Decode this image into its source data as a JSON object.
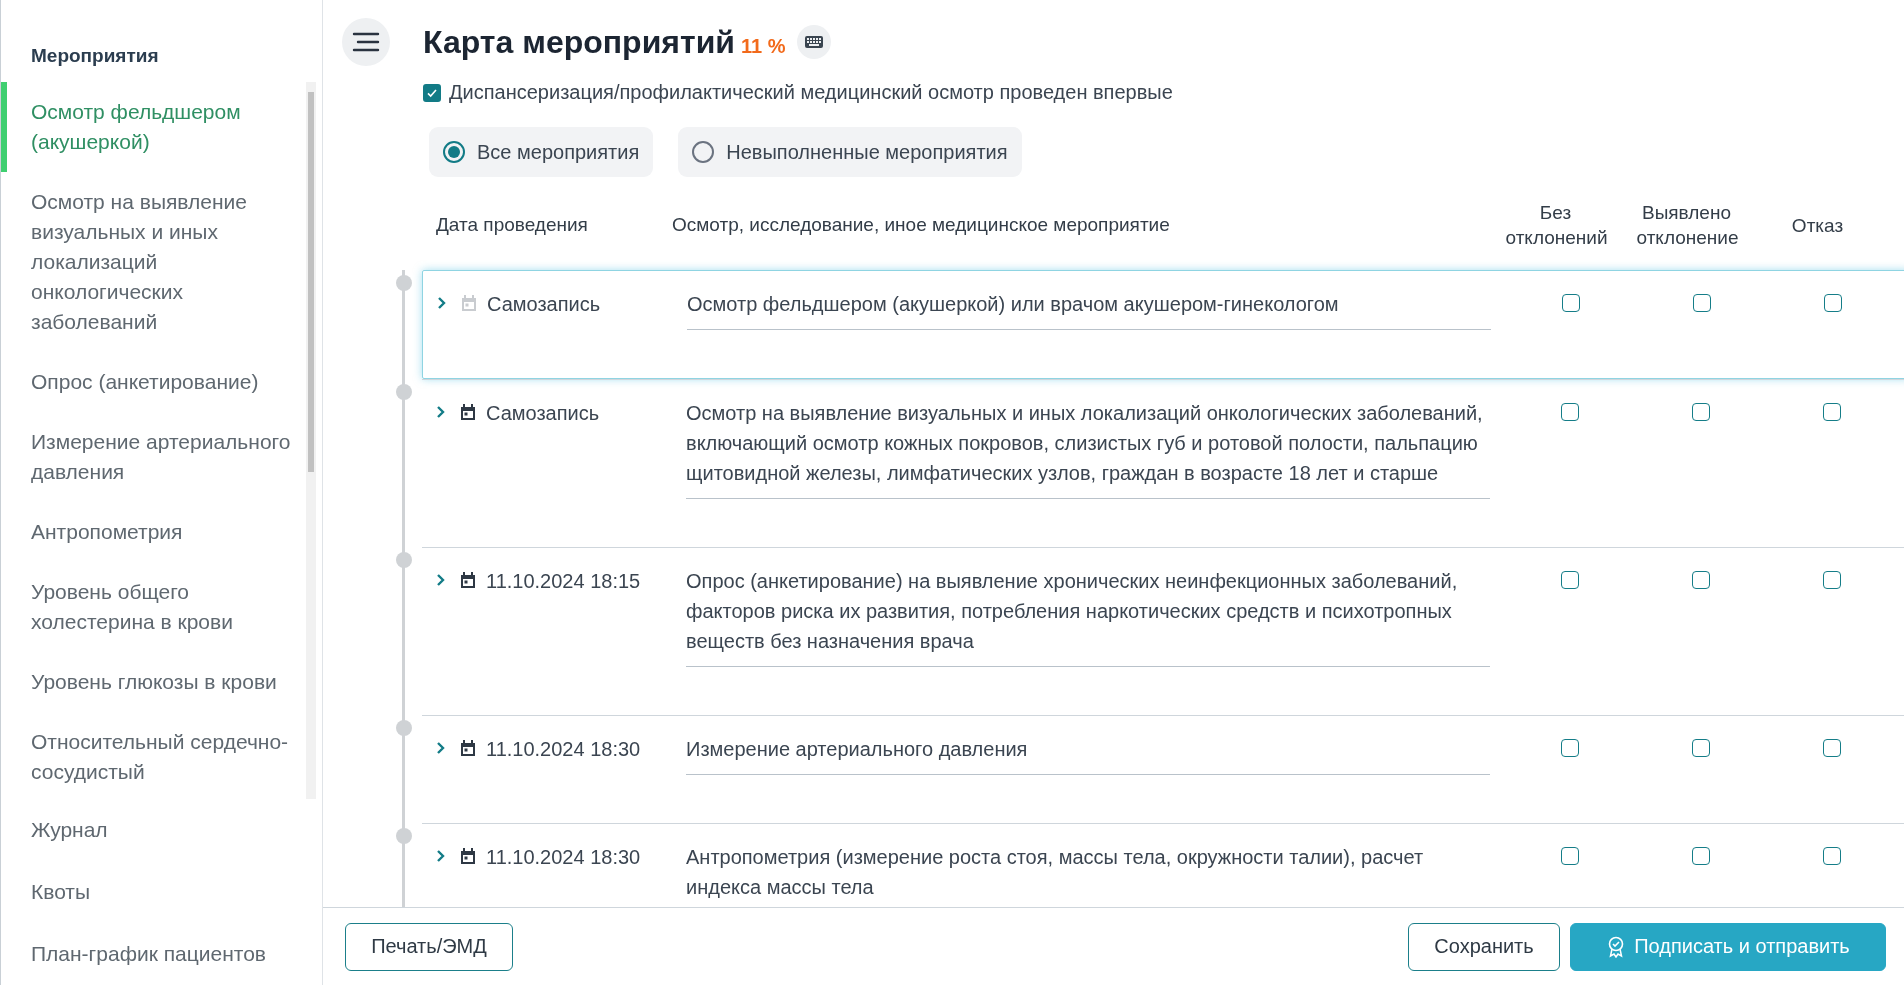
{
  "sidebar": {
    "heading": "Мероприятия",
    "items": [
      {
        "label": "Осмотр фельдшером (акушеркой)",
        "selected": true
      },
      {
        "label": "Осмотр на выявление визуальных и иных локализаций онкологических заболеваний",
        "selected": false
      },
      {
        "label": "Опрос (анкетирование)",
        "selected": false
      },
      {
        "label": "Измерение артериального давления",
        "selected": false
      },
      {
        "label": "Антропометрия",
        "selected": false
      },
      {
        "label": "Уровень общего холестерина в крови",
        "selected": false
      },
      {
        "label": "Уровень глюкозы в крови",
        "selected": false
      },
      {
        "label": "Относительный сердечно-сосудистый",
        "selected": false
      }
    ],
    "links": [
      "Журнал",
      "Квоты",
      "План-график пациентов"
    ]
  },
  "header": {
    "title": "Карта мероприятий",
    "percent": "11 %",
    "first_time": {
      "label": "Диспансеризация/профилактический медицинский осмотр проведен впервые",
      "checked": true
    },
    "filters": [
      {
        "label": "Все мероприятия",
        "selected": true
      },
      {
        "label": "Невыполненные мероприятия",
        "selected": false
      }
    ]
  },
  "table": {
    "columns": [
      "Дата проведения",
      "Осмотр, исследование, иное медицинское мероприятие",
      "Без отклонений",
      "Выявлено отклонение",
      "Отказ"
    ],
    "rows": [
      {
        "date": "Самозапись",
        "date_disabled": true,
        "description": "Осмотр фельдшером (акушеркой) или врачом акушером-гинекологом",
        "selected": true,
        "no_deviation": false,
        "deviation_found": false,
        "refusal": false
      },
      {
        "date": "Самозапись",
        "date_disabled": false,
        "description": "Осмотр на выявление визуальных и иных локализаций онкологических заболеваний, включающий осмотр кожных покровов, слизистых губ и ротовой полости, пальпацию щитовидной железы, лимфатических узлов, граждан в возрасте 18 лет и старше",
        "selected": false,
        "no_deviation": false,
        "deviation_found": false,
        "refusal": false
      },
      {
        "date": "11.10.2024 18:15",
        "date_disabled": false,
        "description": "Опрос (анкетирование) на выявление хронических неинфекционных заболеваний, факторов риска их развития, потребления наркотических средств и психотропных веществ без назначения врача",
        "selected": false,
        "no_deviation": false,
        "deviation_found": false,
        "refusal": false
      },
      {
        "date": "11.10.2024 18:30",
        "date_disabled": false,
        "description": "Измерение артериального давления",
        "selected": false,
        "no_deviation": false,
        "deviation_found": false,
        "refusal": false
      },
      {
        "date": "11.10.2024 18:30",
        "date_disabled": false,
        "description": "Антропометрия (измерение роста стоя, массы тела, окружности талии), расчет индекса массы тела",
        "selected": false,
        "no_deviation": false,
        "deviation_found": false,
        "refusal": false
      }
    ]
  },
  "footer": {
    "print_button": "Печать/ЭМД",
    "save_button": "Сохранить",
    "sign_button": "Подписать и отправить"
  }
}
